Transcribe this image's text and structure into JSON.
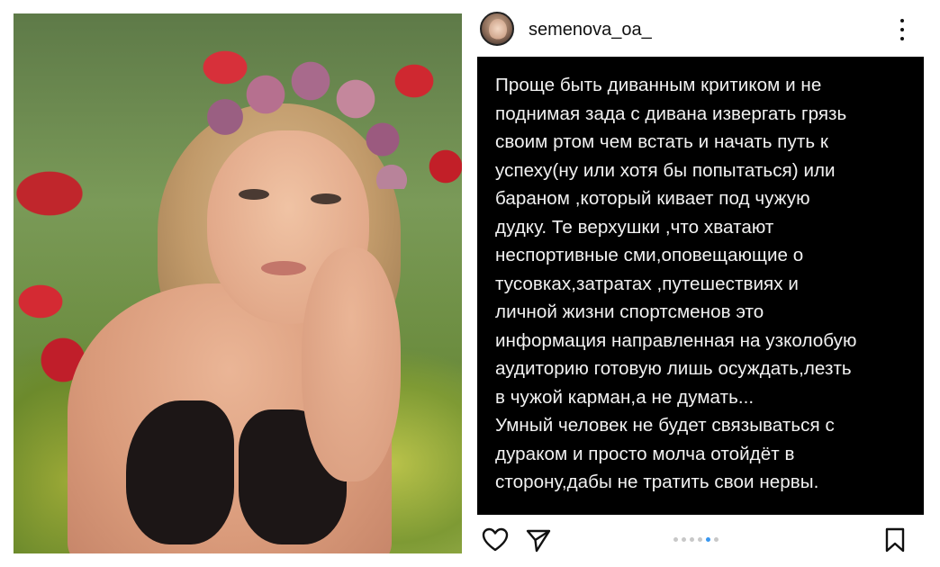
{
  "post": {
    "username": "semenova_oa_",
    "text": "Проще быть диванным критиком и не\nподнимая зада с дивана извергать грязь\nсвоим ртом чем встать и начать путь к\nуспеху(ну или хотя бы попытаться) или\nбараном ,который кивает под чужую\nдудку. Те верхушки ,что хватают\nнеспортивные сми,оповещающие о\nтусовках,затратах ,путешествиях и\nличной жизни спортсменов это\nинформация направленная на узколобую\nаудиторию готовую лишь осуждать,лезть\nв чужой карман,а не думать...\nУмный человек не будет связываться с\nдураком и просто молча отойдёт в\nсторону,дабы не тратить свои нервы.",
    "carousel": {
      "total": 6,
      "active_index": 4
    }
  },
  "icons": {
    "avatar": "profile-avatar",
    "more": "more-options-icon",
    "like": "heart-icon",
    "share": "paper-plane-icon",
    "save": "bookmark-icon"
  },
  "colors": {
    "panel_bg": "#000000",
    "panel_text": "#f2f2f2",
    "active_dot": "#3897f0",
    "inactive_dot": "#c8c8c8"
  }
}
